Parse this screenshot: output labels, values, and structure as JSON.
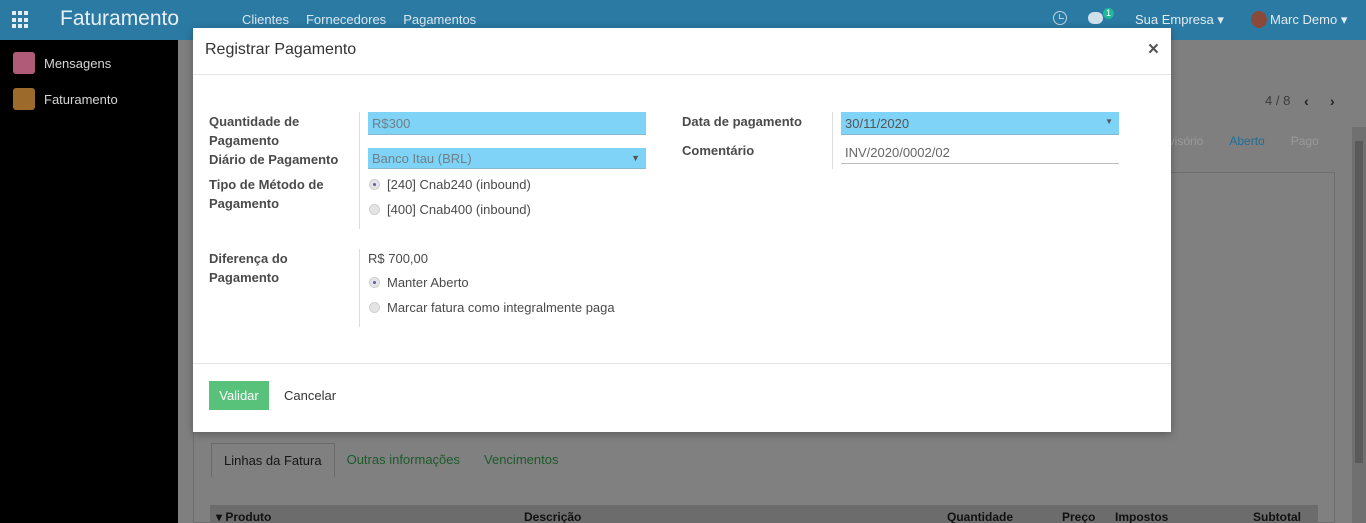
{
  "topbar": {
    "brand": "Faturamento",
    "menu": [
      "Clientes",
      "Fornecedores",
      "Pagamentos"
    ],
    "chat_count": "1",
    "company": "Sua Empresa",
    "user": "Marc Demo",
    "dropdown_glyph": "▾",
    "bg_color": "#2a7aa4"
  },
  "sidebar": {
    "items": [
      {
        "label": "Mensagens",
        "icon": "chat-bubble-icon"
      },
      {
        "label": "Faturamento",
        "icon": "invoice-icon"
      }
    ]
  },
  "background": {
    "pager": "4 / 8",
    "status_steps": [
      "rovisório",
      "Aberto",
      "Pago"
    ],
    "active_status": "Aberto",
    "tabs": [
      "Linhas da Fatura",
      "Outras informações",
      "Vencimentos"
    ],
    "columns": [
      "▾ Produto",
      "Descrição",
      "Quantidade",
      "Preço",
      "Impostos",
      "Subtotal"
    ]
  },
  "modal": {
    "title": "Registrar Pagamento",
    "close_glyph": "×",
    "fields": {
      "amount_label": "Quantidade de Pagamento",
      "amount_value": "R$300",
      "journal_label": "Diário de Pagamento",
      "journal_value": "Banco Itau (BRL)",
      "method_label": "Tipo de Método de Pagamento",
      "method_options": [
        "[240] Cnab240 (inbound)",
        "[400] Cnab400 (inbound)"
      ],
      "method_selected": 0,
      "date_label": "Data de pagamento",
      "date_value": "30/11/2020",
      "comment_label": "Comentário",
      "comment_value": "INV/2020/0002/02",
      "difference_label": "Diferença do Pagamento",
      "difference_value": "R$ 700,00",
      "difference_options": [
        "Manter Aberto",
        "Marcar fatura como integralmente paga"
      ],
      "difference_selected": 0
    },
    "footer": {
      "validate_label": "Validar",
      "cancel_label": "Cancelar"
    },
    "accent_color": "#58c27a",
    "required_field_color": "#7fd3f7"
  }
}
